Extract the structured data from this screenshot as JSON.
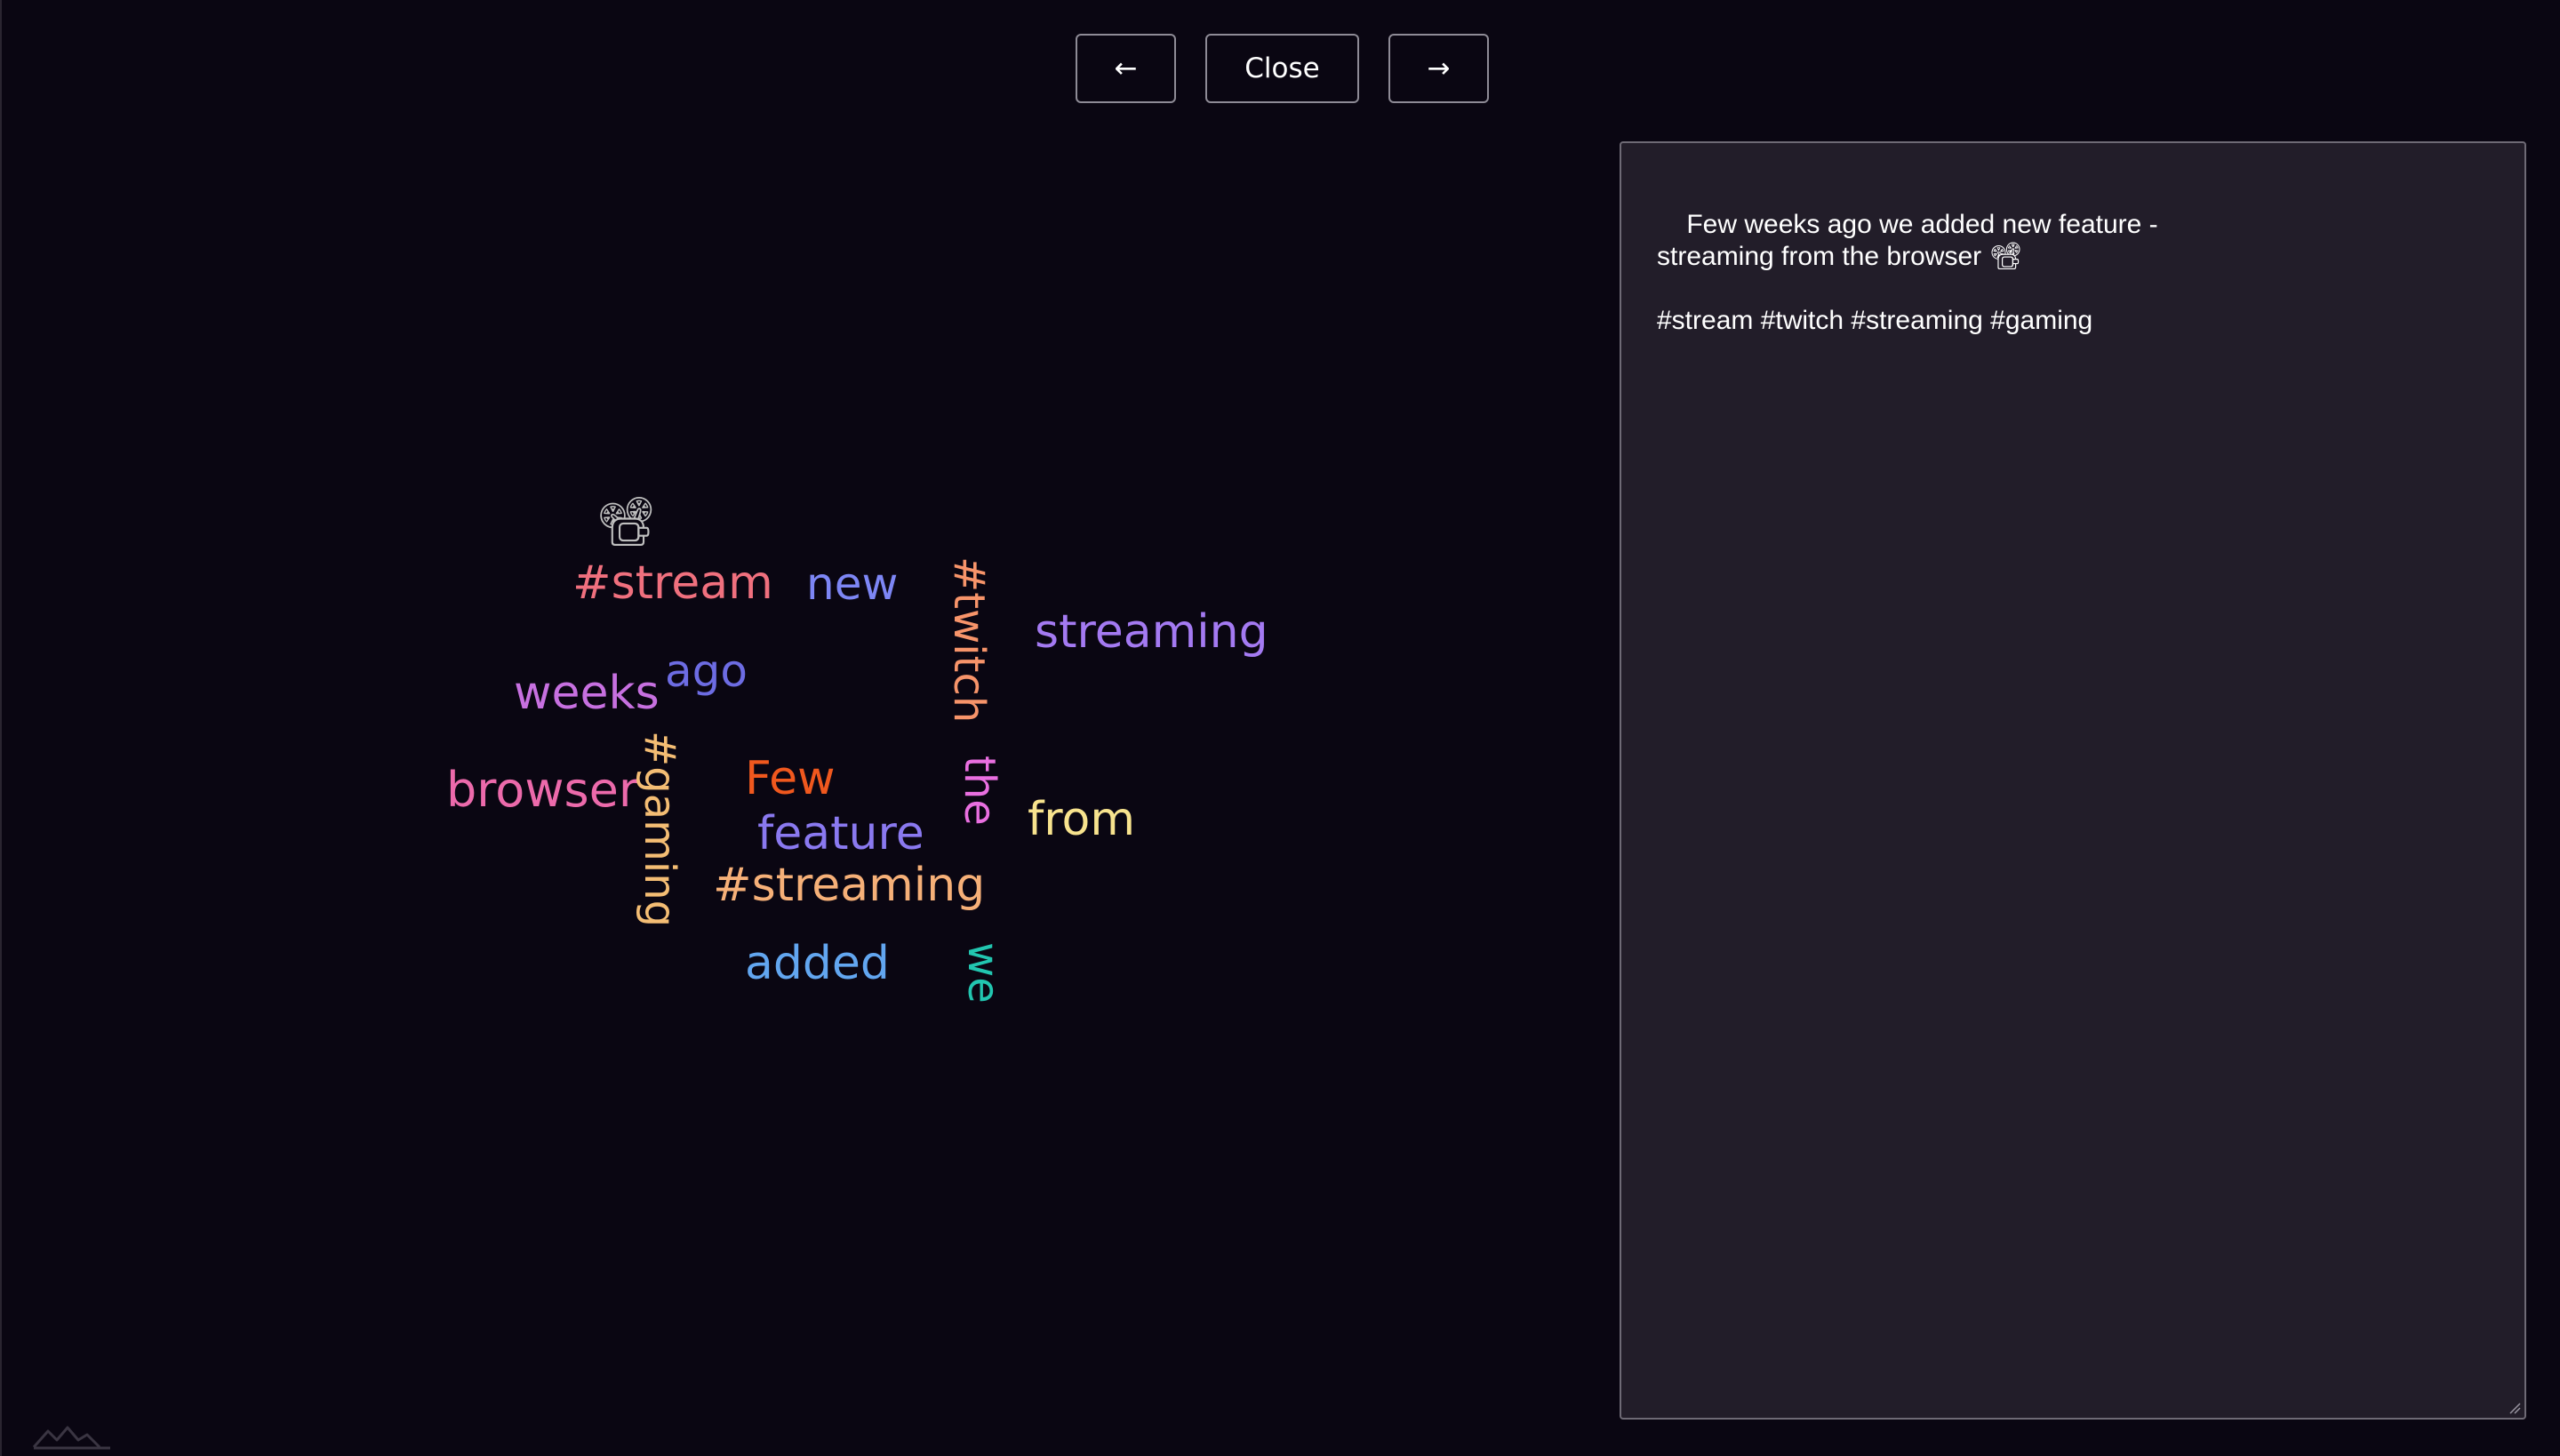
{
  "toolbar": {
    "prev_label": "←",
    "close_label": "Close",
    "next_label": "→"
  },
  "word_cloud": {
    "words": [
      {
        "text": "📽",
        "color": "#bfbfbf",
        "vertical": false
      },
      {
        "text": "#stream",
        "color": "#f0707e",
        "vertical": false
      },
      {
        "text": "new",
        "color": "#7d86f5",
        "vertical": false
      },
      {
        "text": "#twitch",
        "color": "#f7946a",
        "vertical": true
      },
      {
        "text": "streaming",
        "color": "#a47af2",
        "vertical": false
      },
      {
        "text": "weeks",
        "color": "#c770e0",
        "vertical": false
      },
      {
        "text": "ago",
        "color": "#6d6ce3",
        "vertical": false
      },
      {
        "text": "browser",
        "color": "#ec6aab",
        "vertical": false
      },
      {
        "text": "#gaming",
        "color": "#f4bd74",
        "vertical": true
      },
      {
        "text": "Few",
        "color": "#f0581e",
        "vertical": false
      },
      {
        "text": "the",
        "color": "#e96fe0",
        "vertical": true
      },
      {
        "text": "from",
        "color": "#f8e38e",
        "vertical": false
      },
      {
        "text": "feature",
        "color": "#8a79f0",
        "vertical": false
      },
      {
        "text": "#streaming",
        "color": "#f6b078",
        "vertical": false
      },
      {
        "text": "added",
        "color": "#62a6f0",
        "vertical": false
      },
      {
        "text": "we",
        "color": "#22c6b0",
        "vertical": true
      }
    ]
  },
  "editor": {
    "text": "Few weeks ago we added new feature -\nstreaming from the browser 📽\n\n#stream #twitch #streaming #gaming"
  }
}
